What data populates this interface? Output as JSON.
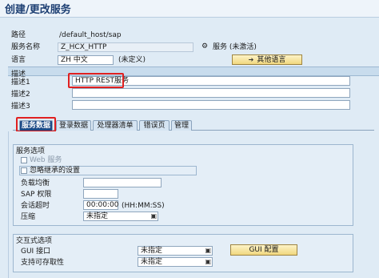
{
  "title": "创建/更改服务",
  "fields": {
    "path_label": "路径",
    "path_value": "/default_host/sap",
    "service_name_label": "服务名称",
    "service_name_value": "Z_HCX_HTTP",
    "service_status": "服务 (未激活)",
    "language_label": "语言",
    "language_code": "ZH 中文",
    "language_note": "(未定义)",
    "other_lang_button": "其他语言"
  },
  "description": {
    "header": "描述",
    "rows": [
      {
        "label": "描述1",
        "value": "HTTP REST服务"
      },
      {
        "label": "描述2",
        "value": ""
      },
      {
        "label": "描述3",
        "value": ""
      }
    ]
  },
  "tabs": [
    "服务数据",
    "登录数据",
    "处理器清单",
    "错误页",
    "管理"
  ],
  "service_options": {
    "title": "服务选项",
    "web_service_label": "Web 服务",
    "ignore_inherit_label": "忽略继承的设置",
    "load_balance_label": "负载均衡",
    "load_balance_value": "",
    "sap_auth_label": "SAP 权限",
    "sap_auth_value": "",
    "timeout_label": "会话超时",
    "timeout_value": "00:00:00",
    "timeout_format": "(HH:MM:SS)",
    "compress_label": "压缩",
    "compress_value": "未指定"
  },
  "interactive_options": {
    "title": "交互式选项",
    "gui_label": "GUI 接口",
    "gui_value": "未指定",
    "accessibility_label": "支持可存取性",
    "accessibility_value": "未指定",
    "gui_config_button": "GUI 配置"
  },
  "colors": {
    "active_tab": "#1d4a86",
    "highlight": "#e02020",
    "button": "#f1d77e"
  }
}
